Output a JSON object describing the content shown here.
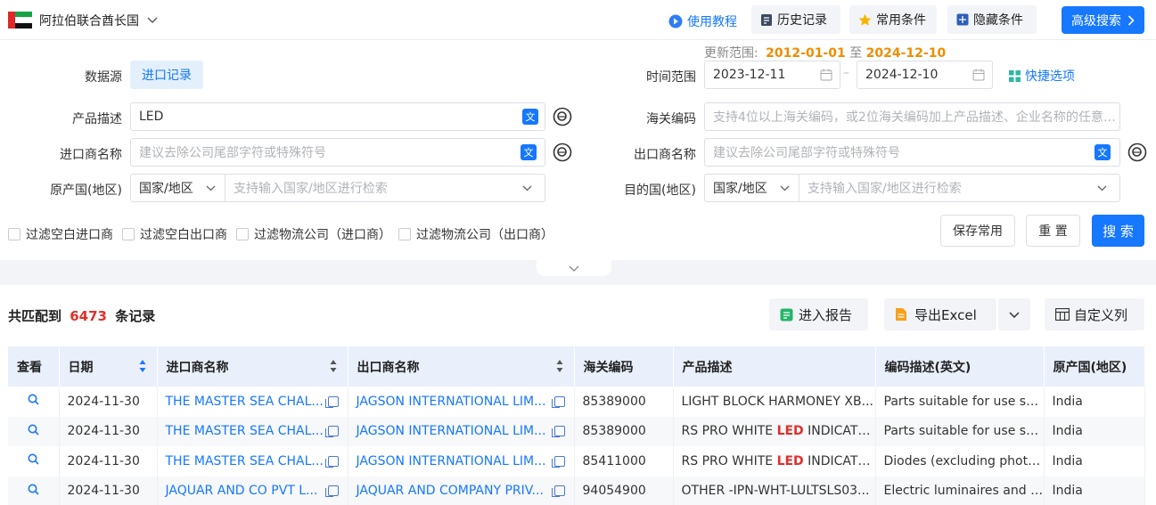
{
  "header": {
    "country": "阿拉伯联合酋长国",
    "tutorial": "使用教程",
    "history": "历史记录",
    "common": "常用条件",
    "hidden": "隐藏条件",
    "advanced": "高级搜索"
  },
  "update_range": {
    "label": "更新范围:",
    "start": "2012-01-01",
    "to": "至",
    "end": "2024-12-10"
  },
  "form": {
    "source_label": "数据源",
    "source_value": "进口记录",
    "time_label": "时间范围",
    "date_from": "2023-12-11",
    "date_sep": "–",
    "date_to": "2024-12-10",
    "quick": "快捷选项",
    "product_label": "产品描述",
    "product_value": "LED",
    "hs_label": "海关编码",
    "hs_placeholder": "支持4位以上海关编码，或2位海关编码加上产品描述、企业名称的任意信...",
    "importer_label": "进口商名称",
    "importer_placeholder": "建议去除公司尾部字符或特殊符号",
    "exporter_label": "出口商名称",
    "exporter_placeholder": "建议去除公司尾部字符或特殊符号",
    "origin_label": "原产国(地区)",
    "origin_select": "国家/地区",
    "origin_placeholder": "支持输入国家/地区进行检索",
    "dest_label": "目的国(地区)",
    "dest_select": "国家/地区",
    "dest_placeholder": "支持输入国家/地区进行检索",
    "filters": [
      "过滤空白进口商",
      "过滤空白出口商",
      "过滤物流公司（进口商）",
      "过滤物流公司（出口商）"
    ],
    "save": "保存常用",
    "reset": "重 置",
    "search": "搜 索",
    "trans_icon": "文"
  },
  "results": {
    "prefix": "共匹配到",
    "count": "6473",
    "suffix": "条记录",
    "report": "进入报告",
    "excel": "导出Excel",
    "columns_btn": "自定义列"
  },
  "table": {
    "headers": [
      "查看",
      "日期",
      "进口商名称",
      "出口商名称",
      "海关编码",
      "产品描述",
      "编码描述(英文)",
      "原产国(地区)"
    ],
    "rows": [
      {
        "date": "2024-11-30",
        "importer": "THE MASTER SEA CHAL...",
        "exporter": "JAGSON INTERNATIONAL LIM...",
        "hs": "85389000",
        "prod_pre": "LIGHT BLOCK HARMONEY XB...",
        "prod_hl": "",
        "prod_post": "",
        "desc": "Parts suitable for use sol...",
        "origin": "India"
      },
      {
        "date": "2024-11-30",
        "importer": "THE MASTER SEA CHAL...",
        "exporter": "JAGSON INTERNATIONAL LIM...",
        "hs": "85389000",
        "prod_pre": "RS PRO WHITE ",
        "prod_hl": "LED",
        "prod_post": " INDICATO...",
        "desc": "Parts suitable for use sol...",
        "origin": "India"
      },
      {
        "date": "2024-11-30",
        "importer": "THE MASTER SEA CHAL...",
        "exporter": "JAGSON INTERNATIONAL LIM...",
        "hs": "85411000",
        "prod_pre": "RS PRO WHITE ",
        "prod_hl": "LED",
        "prod_post": " INDICATO...",
        "desc": "Diodes (excluding photo...",
        "origin": "India"
      },
      {
        "date": "2024-11-30",
        "importer": "JAQUAR AND CO PVT L...",
        "exporter": "JAQUAR AND COMPANY PRIV...",
        "hs": "94054900",
        "prod_pre": "OTHER -IPN-WHT-LULTSLS03...",
        "prod_hl": "",
        "prod_post": "",
        "desc": "Electric luminaires and li...",
        "origin": "India"
      }
    ]
  },
  "colors": {
    "accent": "#1677ff",
    "orange": "#f08c00",
    "red": "#e0302c"
  }
}
